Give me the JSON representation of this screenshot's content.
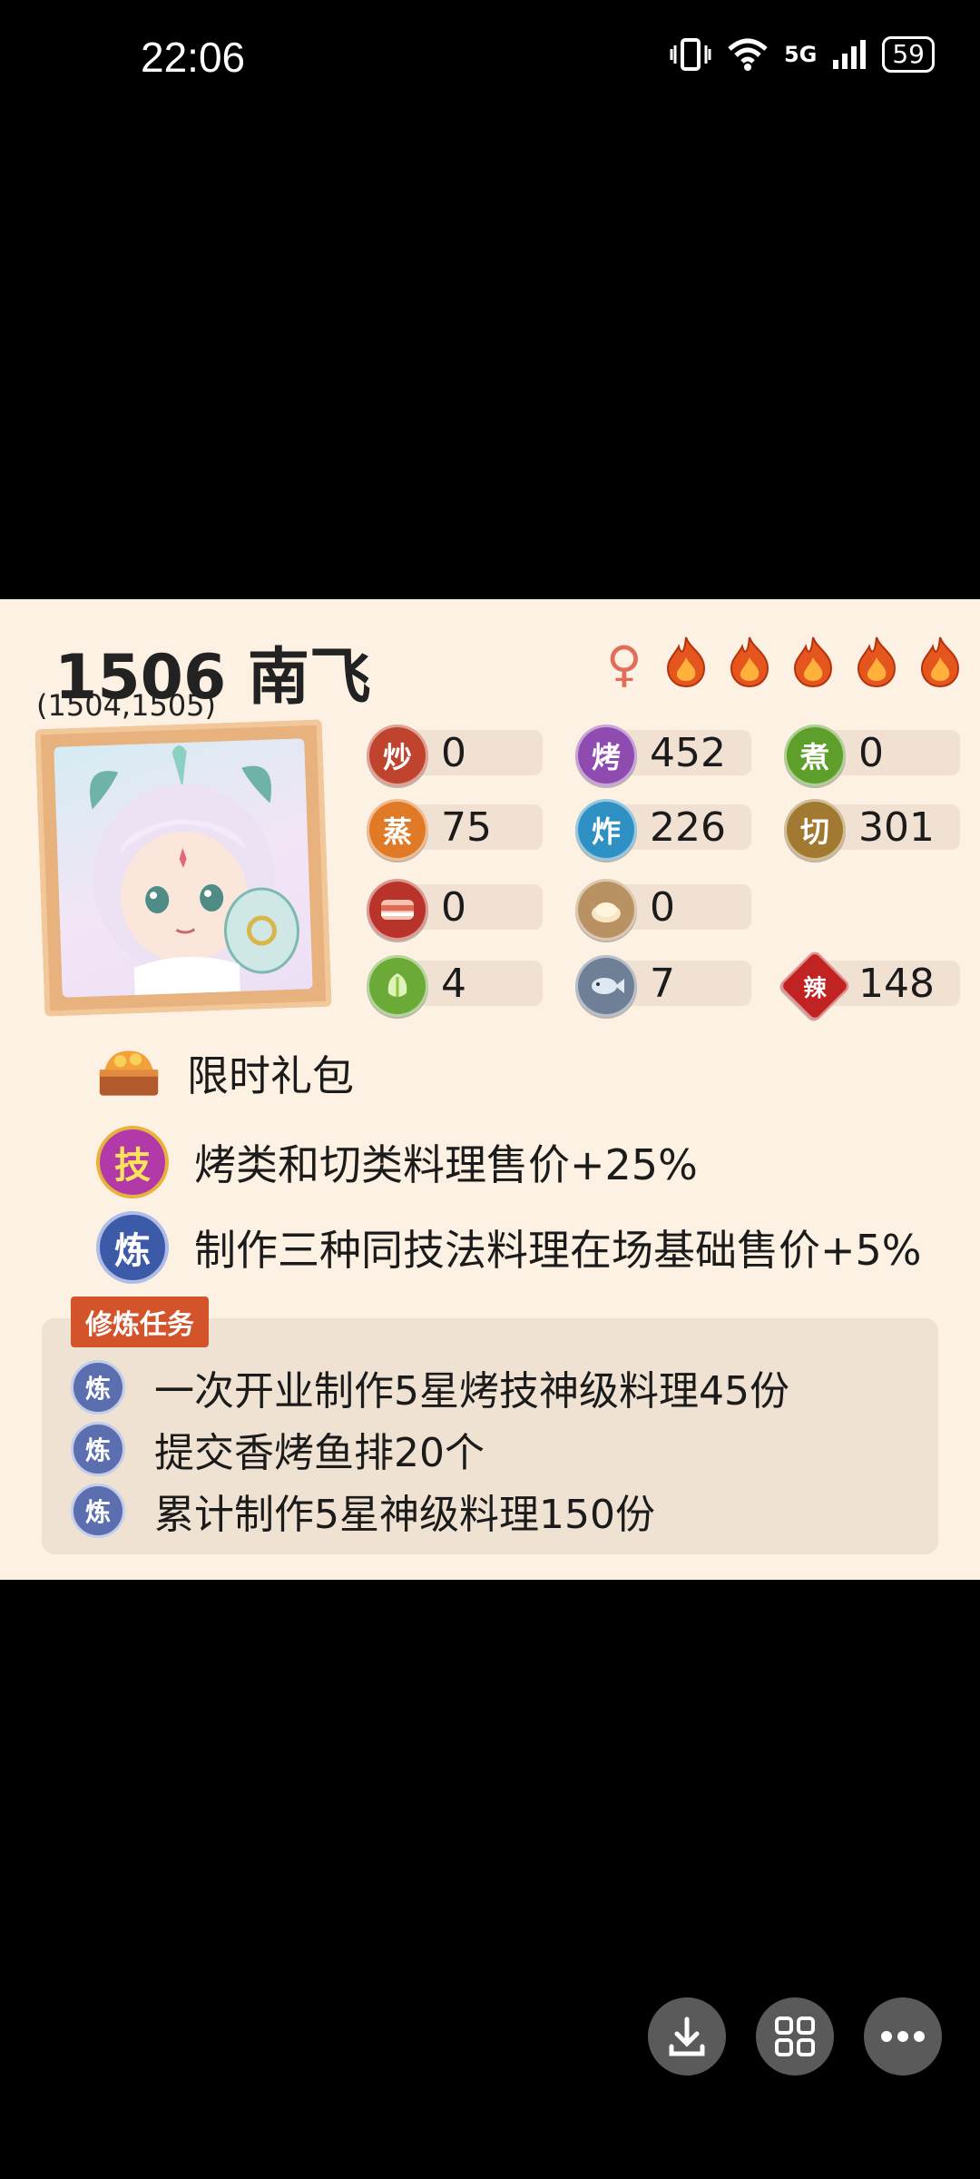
{
  "status_bar": {
    "time": "22:06",
    "network": "5G",
    "battery": "59"
  },
  "chef": {
    "title": "1506 南飞",
    "sub_ids": "(1504,1505)",
    "gender_symbol": "♀",
    "flames": 5
  },
  "stats": [
    {
      "icon": "炒",
      "value": "0",
      "color": "#c0432e"
    },
    {
      "icon": "烤",
      "value": "452",
      "color": "#8f4bb0"
    },
    {
      "icon": "煮",
      "value": "0",
      "color": "#5e9e2a"
    },
    {
      "icon": "蒸",
      "value": "75",
      "color": "#e07a26"
    },
    {
      "icon": "炸",
      "value": "226",
      "color": "#2f90c4"
    },
    {
      "icon": "切",
      "value": "301",
      "color": "#a27930"
    },
    {
      "icon": "meat-icon",
      "value": "0",
      "color": "#b8342a"
    },
    {
      "icon": "flour-icon",
      "value": "0",
      "color": "#b99263"
    },
    {
      "icon": "vegetable-icon",
      "value": "4",
      "color": "#6caa38"
    },
    {
      "icon": "fish-icon",
      "value": "7",
      "color": "#6f7f96"
    },
    {
      "icon": "辣",
      "value": "148",
      "color": "#c12222"
    }
  ],
  "lines": {
    "gift": "限时礼包",
    "skill_icon": "技",
    "skill": "烤类和切类料理售价+25%",
    "refine_icon": "炼",
    "refine": "制作三种同技法料理在场基础售价+5%"
  },
  "tasks": {
    "label": "修炼任务",
    "icon": "炼",
    "items": [
      "一次开业制作5星烤技神级料理45份",
      "提交香烤鱼排20个",
      "累计制作5星神级料理150份"
    ]
  }
}
